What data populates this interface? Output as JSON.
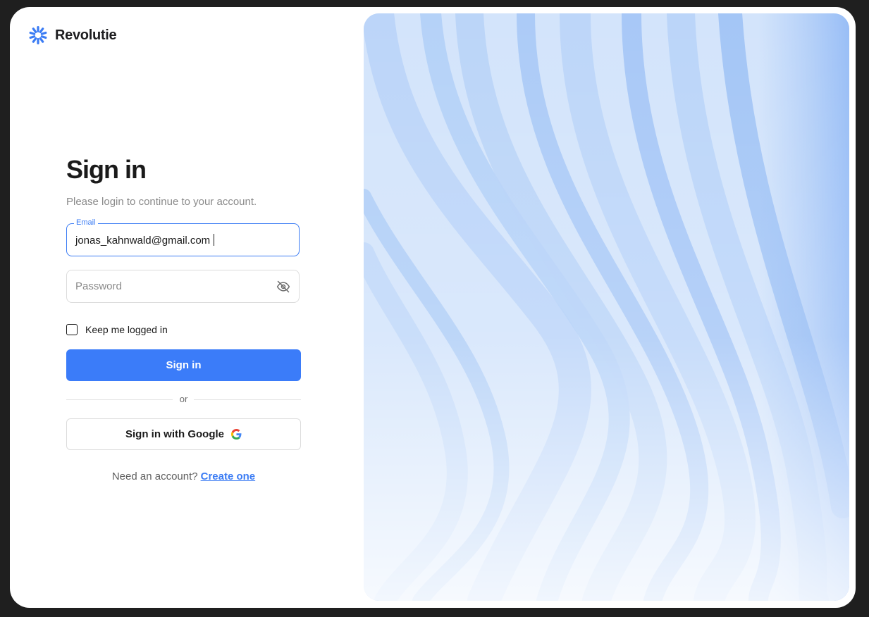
{
  "brand": {
    "name": "Revolutie",
    "icon": "sunburst-logo-icon"
  },
  "form": {
    "title": "Sign in",
    "subtitle": "Please login to continue to your account.",
    "email": {
      "label": "Email",
      "value": "jonas_kahnwald@gmail.com"
    },
    "password": {
      "placeholder": "Password",
      "toggle_icon": "eye-off-icon"
    },
    "keep_logged_in": {
      "label": "Keep me logged in",
      "checked": false
    },
    "submit_label": "Sign in",
    "divider_text": "or",
    "google_label": "Sign in with Google",
    "signup": {
      "prompt": "Need an account?",
      "link": "Create one"
    }
  },
  "colors": {
    "accent": "#3b7cf9",
    "background": "#1f1f1f"
  }
}
